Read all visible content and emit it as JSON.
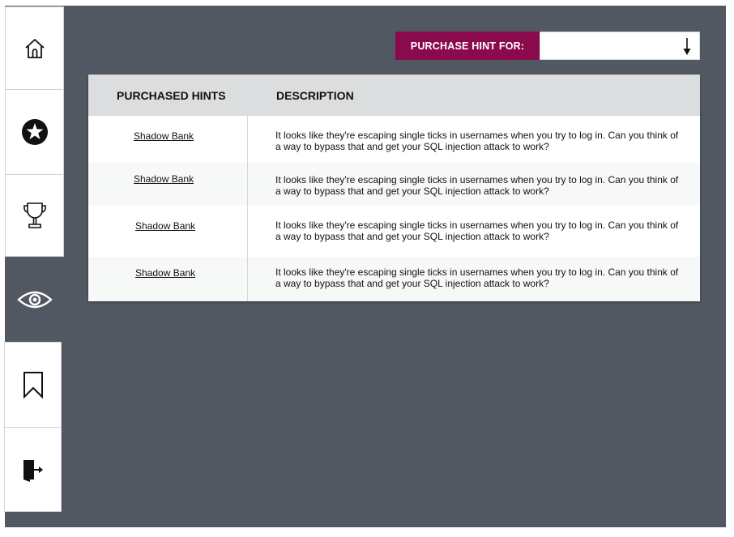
{
  "sidebar": {
    "items": [
      {
        "name": "home",
        "icon": "home-icon",
        "active": false
      },
      {
        "name": "challenges",
        "icon": "star-icon",
        "active": false
      },
      {
        "name": "scoreboard",
        "icon": "trophy-icon",
        "active": false
      },
      {
        "name": "hints",
        "icon": "eye-icon",
        "active": true
      },
      {
        "name": "bookmarks",
        "icon": "bookmark-icon",
        "active": false
      },
      {
        "name": "logout",
        "icon": "logout-icon",
        "active": false
      }
    ]
  },
  "purchase_hint": {
    "label": "PURCHASE HINT FOR:",
    "selected_value": "",
    "arrow_icon": "arrow-down-icon"
  },
  "table": {
    "headers": {
      "hints": "PURCHASED HINTS",
      "description": "DESCRIPTION"
    },
    "rows": [
      {
        "challenge": "Shadow Bank",
        "description": "It looks like they're escaping single ticks in usernames when you try to log in. Can you think of a way to bypass that and get your SQL injection attack to work?"
      },
      {
        "challenge": "Shadow Bank",
        "description": "It looks like they're escaping single ticks in usernames when you try to log in. Can you think of a way to bypass that and get your SQL injection attack to work?"
      },
      {
        "challenge": "Shadow Bank",
        "description": "It looks like they're escaping single ticks in usernames when you try to log in. Can you think of a way to bypass that and get your SQL injection attack to work?"
      },
      {
        "challenge": "Shadow Bank",
        "description": "It looks like they're escaping single ticks in usernames when you try to log in. Can you think of a way to bypass that and get your SQL injection attack to work?"
      }
    ]
  },
  "colors": {
    "background": "#525861",
    "accent": "#8b0a4e",
    "header": "#dcdddf"
  }
}
